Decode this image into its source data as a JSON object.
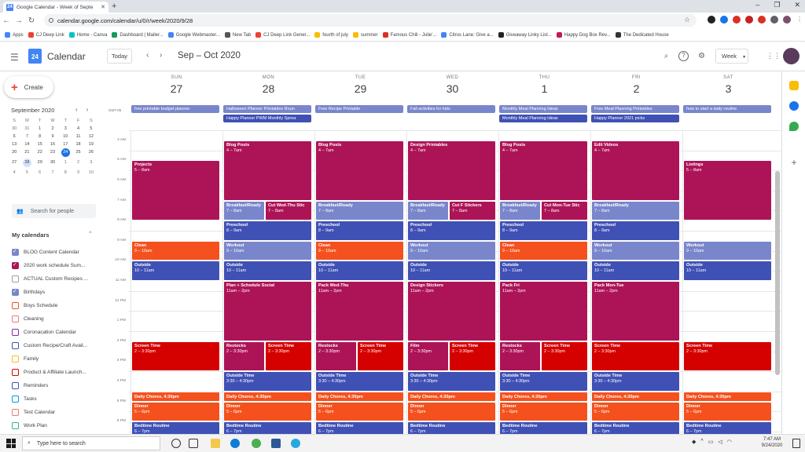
{
  "browser": {
    "tab_title": "Google Calendar - Week of Septe",
    "tab_favicon": "24",
    "url": "calendar.google.com/calendar/u/0/r/week/2020/9/28",
    "bookmarks": [
      "Apps",
      "CJ Deep Link",
      "Home - Canva",
      "Dashboard | Mailer...",
      "Google Webmaster...",
      "New Tab",
      "CJ Deep Link Gener...",
      "fourth of july",
      "summer",
      "Famous Chili - Julie'...",
      "Citrus Lane: Give a...",
      "Giveaway Linky List...",
      "Happy Dog Box Rev...",
      "The Dedicated House"
    ]
  },
  "header": {
    "logo_num": "24",
    "app_name": "Calendar",
    "today_label": "Today",
    "period": "Sep – Oct 2020",
    "view_label": "Week"
  },
  "sidebar": {
    "create_label": "Create",
    "mini_month": "September 2020",
    "mini_dow": [
      "S",
      "M",
      "T",
      "W",
      "T",
      "F",
      "S"
    ],
    "mini_days": [
      "30",
      "31",
      "1",
      "2",
      "3",
      "4",
      "5",
      "6",
      "7",
      "8",
      "9",
      "10",
      "11",
      "12",
      "13",
      "14",
      "15",
      "16",
      "17",
      "18",
      "19",
      "20",
      "21",
      "22",
      "23",
      "24",
      "25",
      "26",
      "27",
      "28",
      "29",
      "30",
      "1",
      "2",
      "3",
      "4",
      "5",
      "6",
      "7",
      "8",
      "9",
      "10"
    ],
    "search_people": "Search for people",
    "my_calendars": "My calendars",
    "calendars": [
      {
        "name": "BLOG Content Calendar",
        "color": "#7986cb",
        "checked": true
      },
      {
        "name": "2020 work schedule Sum...",
        "color": "#ad1457",
        "checked": true
      },
      {
        "name": "ACTUAL Custom Recipes ...",
        "color": "#9e9e9e",
        "checked": false
      },
      {
        "name": "Birthdays",
        "color": "#7986cb",
        "checked": true
      },
      {
        "name": "Boys Schedule",
        "color": "#f4511e",
        "checked": false
      },
      {
        "name": "Cleaning",
        "color": "#e67c73",
        "checked": false
      },
      {
        "name": "Coronacation Calendar",
        "color": "#8e24aa",
        "checked": false
      },
      {
        "name": "Custom Recipe/Craft Avail...",
        "color": "#3f51b5",
        "checked": false
      },
      {
        "name": "Family",
        "color": "#f6bf26",
        "checked": false
      },
      {
        "name": "Product & Affiliate Launch...",
        "color": "#d50000",
        "checked": false
      },
      {
        "name": "Reminders",
        "color": "#3f51b5",
        "checked": false
      },
      {
        "name": "Tasks",
        "color": "#039be5",
        "checked": false
      },
      {
        "name": "Test Calendar",
        "color": "#e67c73",
        "checked": false
      },
      {
        "name": "Work Plan",
        "color": "#33b679",
        "checked": false
      }
    ]
  },
  "week": {
    "gmt": "GMT-05",
    "days": [
      {
        "dow": "SUN",
        "num": "27"
      },
      {
        "dow": "MON",
        "num": "28"
      },
      {
        "dow": "TUE",
        "num": "29"
      },
      {
        "dow": "WED",
        "num": "30"
      },
      {
        "dow": "THU",
        "num": "1"
      },
      {
        "dow": "FRI",
        "num": "2"
      },
      {
        "dow": "SAT",
        "num": "3"
      }
    ],
    "time_labels": [
      "4 AM",
      "5 AM",
      "6 AM",
      "7 AM",
      "8 AM",
      "9 AM",
      "10 AM",
      "11 AM",
      "12 PM",
      "1 PM",
      "2 PM",
      "3 PM",
      "4 PM",
      "5 PM",
      "6 PM"
    ],
    "allday": [
      {
        "day": 0,
        "row": 0,
        "title": "free printable budget planner",
        "color": "#7986cb"
      },
      {
        "day": 1,
        "row": 0,
        "title": "Halloween Planner Printables Roun",
        "color": "#7986cb"
      },
      {
        "day": 1,
        "row": 1,
        "title": "Happy Planner PWM Monthly Sprea",
        "color": "#3f51b5"
      },
      {
        "day": 2,
        "row": 0,
        "title": "Free Recipe Printable",
        "color": "#7986cb"
      },
      {
        "day": 3,
        "row": 0,
        "title": "Fall activities for kids",
        "color": "#7986cb"
      },
      {
        "day": 4,
        "row": 0,
        "title": "Monthly Meal Planning Ideas",
        "color": "#7986cb"
      },
      {
        "day": 4,
        "row": 1,
        "title": "Monthly Meal Planning Ideas",
        "color": "#3f51b5"
      },
      {
        "day": 5,
        "row": 0,
        "title": "Free Meal Planning Printables",
        "color": "#7986cb"
      },
      {
        "day": 5,
        "row": 1,
        "title": "Happy Planner 2021 picks",
        "color": "#3f51b5"
      },
      {
        "day": 6,
        "row": 0,
        "title": "how to start a daily routine",
        "color": "#7986cb"
      }
    ],
    "events": [
      {
        "day": 0,
        "start": 5,
        "end": 8,
        "title": "Projects",
        "time": "5 – 8am",
        "color": "#ad1457"
      },
      {
        "day": 0,
        "start": 9,
        "end": 10,
        "title": "Clean",
        "time": "9 – 10am",
        "color": "#f4511e"
      },
      {
        "day": 0,
        "start": 10,
        "end": 11,
        "title": "Outside",
        "time": "10 – 11am",
        "color": "#3f51b5"
      },
      {
        "day": 0,
        "start": 14,
        "end": 15.5,
        "title": "Screen Time",
        "time": "2 – 3:30pm",
        "color": "#d50000"
      },
      {
        "day": 0,
        "start": 16.5,
        "end": 17,
        "title": "Daily Chores, 4:30pm",
        "time": "",
        "color": "#f4511e",
        "inline": true
      },
      {
        "day": 0,
        "start": 17,
        "end": 18,
        "title": "Dinner",
        "time": "5 – 6pm",
        "color": "#f4511e"
      },
      {
        "day": 0,
        "start": 18,
        "end": 19,
        "title": "Bedtime Routine",
        "time": "6 – 7pm",
        "color": "#3f51b5"
      },
      {
        "day": 1,
        "start": 4,
        "end": 7,
        "title": "Blog Posts",
        "time": "4 – 7am",
        "color": "#ad1457"
      },
      {
        "day": 1,
        "start": 7,
        "end": 8,
        "title": "Breakfast/Ready",
        "time": "7 – 8am",
        "color": "#7986cb",
        "half": 0
      },
      {
        "day": 1,
        "start": 7,
        "end": 8,
        "title": "Cut Wed-Thu Stic",
        "time": "7 – 8am",
        "color": "#ad1457",
        "half": 1
      },
      {
        "day": 1,
        "start": 8,
        "end": 9,
        "title": "Preschool",
        "time": "8 – 9am",
        "color": "#3f51b5"
      },
      {
        "day": 1,
        "start": 9,
        "end": 10,
        "title": "Workout",
        "time": "9 – 10am",
        "color": "#7986cb"
      },
      {
        "day": 1,
        "start": 10,
        "end": 11,
        "title": "Outside",
        "time": "10 – 11am",
        "color": "#3f51b5"
      },
      {
        "day": 1,
        "start": 11,
        "end": 14,
        "title": "Plan + Schedule Social",
        "time": "11am – 2pm",
        "color": "#ad1457"
      },
      {
        "day": 1,
        "start": 14,
        "end": 15.5,
        "title": "Restocks",
        "time": "2 – 3:30pm",
        "color": "#ad1457",
        "half": 0
      },
      {
        "day": 1,
        "start": 14,
        "end": 15.5,
        "title": "Screen Time",
        "time": "2 – 3:30pm",
        "color": "#d50000",
        "half": 1
      },
      {
        "day": 1,
        "start": 15.5,
        "end": 16.5,
        "title": "Outside Time",
        "time": "3:30 – 4:30pm",
        "color": "#3f51b5"
      },
      {
        "day": 1,
        "start": 16.5,
        "end": 17,
        "title": "Daily Chores, 4:30pm",
        "time": "",
        "color": "#f4511e",
        "inline": true
      },
      {
        "day": 1,
        "start": 17,
        "end": 18,
        "title": "Dinner",
        "time": "5 – 6pm",
        "color": "#f4511e"
      },
      {
        "day": 1,
        "start": 18,
        "end": 19,
        "title": "Bedtime Routine",
        "time": "6 – 7pm",
        "color": "#3f51b5"
      },
      {
        "day": 2,
        "start": 4,
        "end": 7,
        "title": "Blog Posts",
        "time": "4 – 7am",
        "color": "#ad1457"
      },
      {
        "day": 2,
        "start": 7,
        "end": 8,
        "title": "Breakfast/Ready",
        "time": "7 – 8am",
        "color": "#7986cb"
      },
      {
        "day": 2,
        "start": 8,
        "end": 9,
        "title": "Preschool",
        "time": "8 – 9am",
        "color": "#3f51b5"
      },
      {
        "day": 2,
        "start": 9,
        "end": 10,
        "title": "Clean",
        "time": "9 – 10am",
        "color": "#f4511e"
      },
      {
        "day": 2,
        "start": 10,
        "end": 11,
        "title": "Outside",
        "time": "10 – 11am",
        "color": "#3f51b5"
      },
      {
        "day": 2,
        "start": 11,
        "end": 14,
        "title": "Pack Wed-Thu",
        "time": "11am – 2pm",
        "color": "#ad1457"
      },
      {
        "day": 2,
        "start": 14,
        "end": 15.5,
        "title": "Restocks",
        "time": "2 – 3:30pm",
        "color": "#ad1457",
        "half": 0
      },
      {
        "day": 2,
        "start": 14,
        "end": 15.5,
        "title": "Screen Time",
        "time": "2 – 3:30pm",
        "color": "#d50000",
        "half": 1
      },
      {
        "day": 2,
        "start": 15.5,
        "end": 16.5,
        "title": "Outside Time",
        "time": "3:30 – 4:30pm",
        "color": "#3f51b5"
      },
      {
        "day": 2,
        "start": 16.5,
        "end": 17,
        "title": "Daily Chores, 4:30pm",
        "time": "",
        "color": "#f4511e",
        "inline": true
      },
      {
        "day": 2,
        "start": 17,
        "end": 18,
        "title": "Dinner",
        "time": "5 – 6pm",
        "color": "#f4511e"
      },
      {
        "day": 2,
        "start": 18,
        "end": 19,
        "title": "Bedtime Routine",
        "time": "6 – 7pm",
        "color": "#3f51b5"
      },
      {
        "day": 3,
        "start": 4,
        "end": 7,
        "title": "Design Printables",
        "time": "4 – 7am",
        "color": "#ad1457"
      },
      {
        "day": 3,
        "start": 7,
        "end": 8,
        "title": "Breakfast/Ready",
        "time": "7 – 8am",
        "color": "#7986cb",
        "half": 0
      },
      {
        "day": 3,
        "start": 7,
        "end": 8,
        "title": "Cut F Stickers",
        "time": "7 – 8am",
        "color": "#ad1457",
        "half": 1
      },
      {
        "day": 3,
        "start": 8,
        "end": 9,
        "title": "Preschool",
        "time": "8 – 9am",
        "color": "#3f51b5"
      },
      {
        "day": 3,
        "start": 9,
        "end": 10,
        "title": "Workout",
        "time": "9 – 10am",
        "color": "#7986cb"
      },
      {
        "day": 3,
        "start": 10,
        "end": 11,
        "title": "Outside",
        "time": "10 – 11am",
        "color": "#3f51b5"
      },
      {
        "day": 3,
        "start": 11,
        "end": 14,
        "title": "Design Stickers",
        "time": "11am – 2pm",
        "color": "#ad1457"
      },
      {
        "day": 3,
        "start": 14,
        "end": 15.5,
        "title": "Film",
        "time": "2 – 3:30pm",
        "color": "#ad1457",
        "half": 0
      },
      {
        "day": 3,
        "start": 14,
        "end": 15.5,
        "title": "Screen Time",
        "time": "2 – 3:30pm",
        "color": "#d50000",
        "half": 1
      },
      {
        "day": 3,
        "start": 15.5,
        "end": 16.5,
        "title": "Outside Time",
        "time": "3:30 – 4:30pm",
        "color": "#3f51b5"
      },
      {
        "day": 3,
        "start": 16.5,
        "end": 17,
        "title": "Daily Chores, 4:30pm",
        "time": "",
        "color": "#f4511e",
        "inline": true
      },
      {
        "day": 3,
        "start": 17,
        "end": 18,
        "title": "Dinner",
        "time": "5 – 6pm",
        "color": "#f4511e"
      },
      {
        "day": 3,
        "start": 18,
        "end": 19,
        "title": "Bedtime Routine",
        "time": "6 – 7pm",
        "color": "#3f51b5"
      },
      {
        "day": 4,
        "start": 4,
        "end": 7,
        "title": "Blog Posts",
        "time": "4 – 7am",
        "color": "#ad1457"
      },
      {
        "day": 4,
        "start": 7,
        "end": 8,
        "title": "Breakfast/Ready",
        "time": "7 – 8am",
        "color": "#7986cb",
        "half": 0
      },
      {
        "day": 4,
        "start": 7,
        "end": 8,
        "title": "Cut Mon-Tue Stic",
        "time": "7 – 8am",
        "color": "#ad1457",
        "half": 1
      },
      {
        "day": 4,
        "start": 8,
        "end": 9,
        "title": "Preschool",
        "time": "8 – 9am",
        "color": "#3f51b5"
      },
      {
        "day": 4,
        "start": 9,
        "end": 10,
        "title": "Clean",
        "time": "9 – 10am",
        "color": "#f4511e"
      },
      {
        "day": 4,
        "start": 10,
        "end": 11,
        "title": "Outside",
        "time": "10 – 11am",
        "color": "#3f51b5"
      },
      {
        "day": 4,
        "start": 11,
        "end": 14,
        "title": "Pack Fri",
        "time": "11am – 2pm",
        "color": "#ad1457"
      },
      {
        "day": 4,
        "start": 14,
        "end": 15.5,
        "title": "Restocks",
        "time": "2 – 3:30pm",
        "color": "#ad1457",
        "half": 0
      },
      {
        "day": 4,
        "start": 14,
        "end": 15.5,
        "title": "Screen Time",
        "time": "2 – 3:30pm",
        "color": "#d50000",
        "half": 1
      },
      {
        "day": 4,
        "start": 15.5,
        "end": 16.5,
        "title": "Outside Time",
        "time": "3:30 – 4:30pm",
        "color": "#3f51b5"
      },
      {
        "day": 4,
        "start": 16.5,
        "end": 17,
        "title": "Daily Chores, 4:30pm",
        "time": "",
        "color": "#f4511e",
        "inline": true
      },
      {
        "day": 4,
        "start": 17,
        "end": 18,
        "title": "Dinner",
        "time": "5 – 6pm",
        "color": "#f4511e"
      },
      {
        "day": 4,
        "start": 18,
        "end": 19,
        "title": "Bedtime Routine",
        "time": "6 – 7pm",
        "color": "#3f51b5"
      },
      {
        "day": 5,
        "start": 4,
        "end": 7,
        "title": "Edit Videos",
        "time": "4 – 7am",
        "color": "#ad1457"
      },
      {
        "day": 5,
        "start": 7,
        "end": 8,
        "title": "Breakfast/Ready",
        "time": "7 – 8am",
        "color": "#7986cb"
      },
      {
        "day": 5,
        "start": 8,
        "end": 9,
        "title": "Preschool",
        "time": "8 – 9am",
        "color": "#3f51b5"
      },
      {
        "day": 5,
        "start": 9,
        "end": 10,
        "title": "Workout",
        "time": "9 – 10am",
        "color": "#7986cb"
      },
      {
        "day": 5,
        "start": 10,
        "end": 11,
        "title": "Outside",
        "time": "10 – 11am",
        "color": "#3f51b5"
      },
      {
        "day": 5,
        "start": 11,
        "end": 14,
        "title": "Pack Mon-Tue",
        "time": "11am – 2pm",
        "color": "#ad1457"
      },
      {
        "day": 5,
        "start": 14,
        "end": 15.5,
        "title": "Screen Time",
        "time": "2 – 3:30pm",
        "color": "#d50000"
      },
      {
        "day": 5,
        "start": 15.5,
        "end": 16.5,
        "title": "Outside Time",
        "time": "3:30 – 4:30pm",
        "color": "#3f51b5"
      },
      {
        "day": 5,
        "start": 16.5,
        "end": 17,
        "title": "Daily Chores, 4:30pm",
        "time": "",
        "color": "#f4511e",
        "inline": true
      },
      {
        "day": 5,
        "start": 17,
        "end": 18,
        "title": "Dinner",
        "time": "5 – 6pm",
        "color": "#f4511e"
      },
      {
        "day": 5,
        "start": 18,
        "end": 19,
        "title": "Bedtime Routine",
        "time": "6 – 7pm",
        "color": "#3f51b5"
      },
      {
        "day": 6,
        "start": 5,
        "end": 8,
        "title": "Listings",
        "time": "5 – 8am",
        "color": "#ad1457"
      },
      {
        "day": 6,
        "start": 9,
        "end": 10,
        "title": "Workout",
        "time": "9 – 10am",
        "color": "#7986cb"
      },
      {
        "day": 6,
        "start": 10,
        "end": 11,
        "title": "Outside",
        "time": "10 – 11am",
        "color": "#3f51b5"
      },
      {
        "day": 6,
        "start": 14,
        "end": 15.5,
        "title": "Screen Time",
        "time": "2 – 3:30pm",
        "color": "#d50000"
      },
      {
        "day": 6,
        "start": 16.5,
        "end": 17,
        "title": "Daily Chores, 4:30pm",
        "time": "",
        "color": "#f4511e",
        "inline": true
      },
      {
        "day": 6,
        "start": 17,
        "end": 18,
        "title": "Dinner",
        "time": "5 – 6pm",
        "color": "#f4511e"
      },
      {
        "day": 6,
        "start": 18,
        "end": 19,
        "title": "Bedtime Routine",
        "time": "6 – 7pm",
        "color": "#3f51b5"
      }
    ]
  },
  "taskbar": {
    "search_placeholder": "Type here to search",
    "time": "7:47 AM",
    "date": "9/24/2020"
  }
}
